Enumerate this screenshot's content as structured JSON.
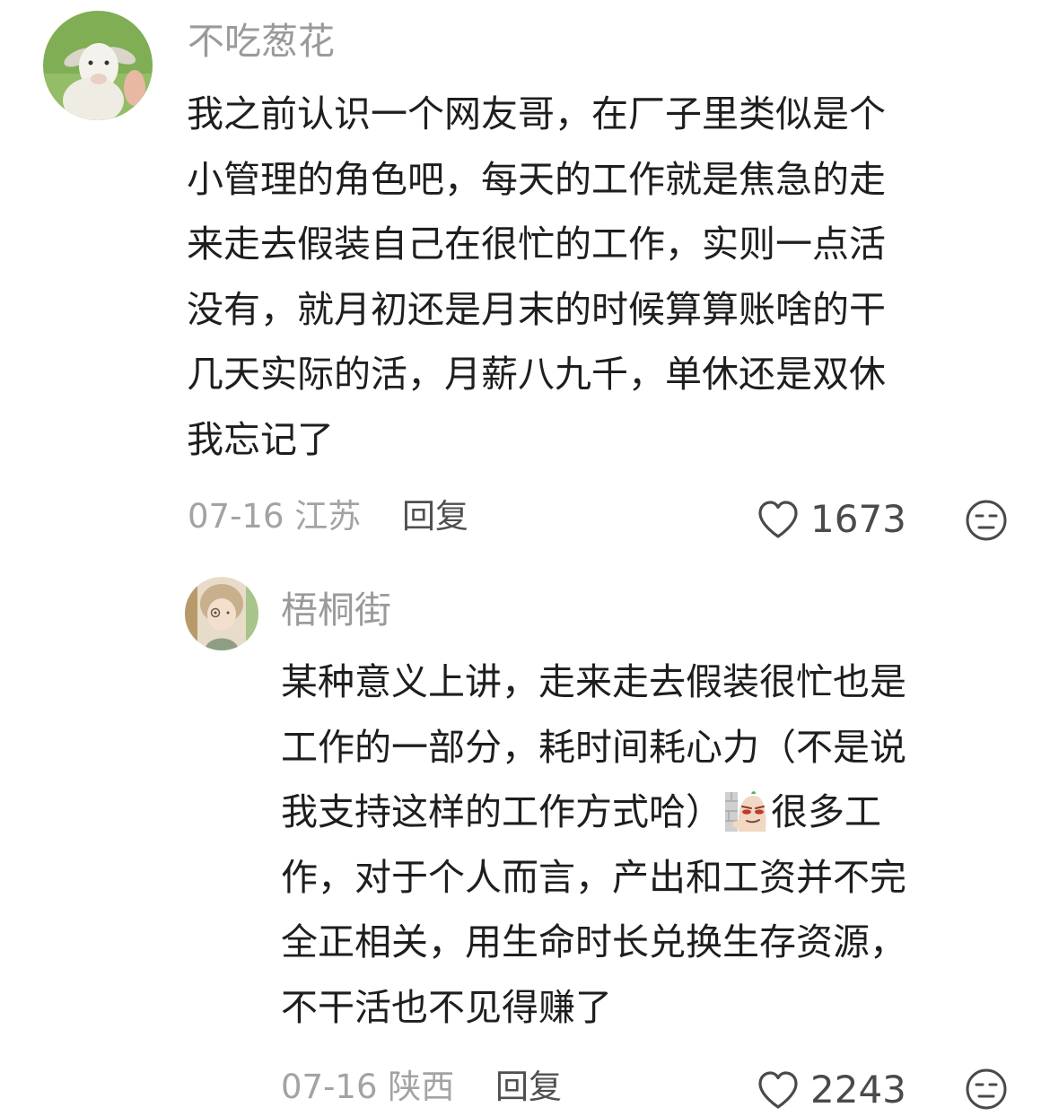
{
  "comments": [
    {
      "username": "不吃葱花",
      "avatar_icon": "goat-avatar-icon",
      "lines": [
        "我之前认识一个网友哥，在厂子里类似是个",
        "小管理的角色吧，每天的工作就是焦急的走",
        "来走去假装自己在很忙的工作，实则一点活",
        "没有，就月初还是月末的时候算算账啥的干",
        "几天实际的活，月薪八九千，单休还是双休",
        "我忘记了"
      ],
      "date_location": "07-16 江苏",
      "reply_label": "回复",
      "like_count": "1673"
    },
    {
      "username": "梧桐街",
      "avatar_icon": "anime-character-avatar-icon",
      "lines_before_emoji": [
        "某种意义上讲，走来走去假装很忙也是",
        "工作的一部分，耗时间耗心力（不是说"
      ],
      "emoji_line_before": "我支持这样的工作方式哈）",
      "emoji_name": "smug-face-emoji-icon",
      "emoji_line_after": "很多工",
      "lines_after_emoji": [
        "作，对于个人而言，产出和工资并不完",
        "全正相关，用生命时长兑换生存资源，",
        "不干活也不见得赚了"
      ],
      "date_location": "07-16 陕西",
      "reply_label": "回复",
      "like_count": "2243"
    }
  ],
  "icons": {
    "like": "heart-outline-icon",
    "dislike": "unamused-face-icon"
  },
  "colors": {
    "username": "#9a9a9a",
    "text": "#1e1e1e",
    "meta": "#a3a3a3",
    "reply": "#4f4f4f",
    "icon": "#4a4a4a"
  }
}
